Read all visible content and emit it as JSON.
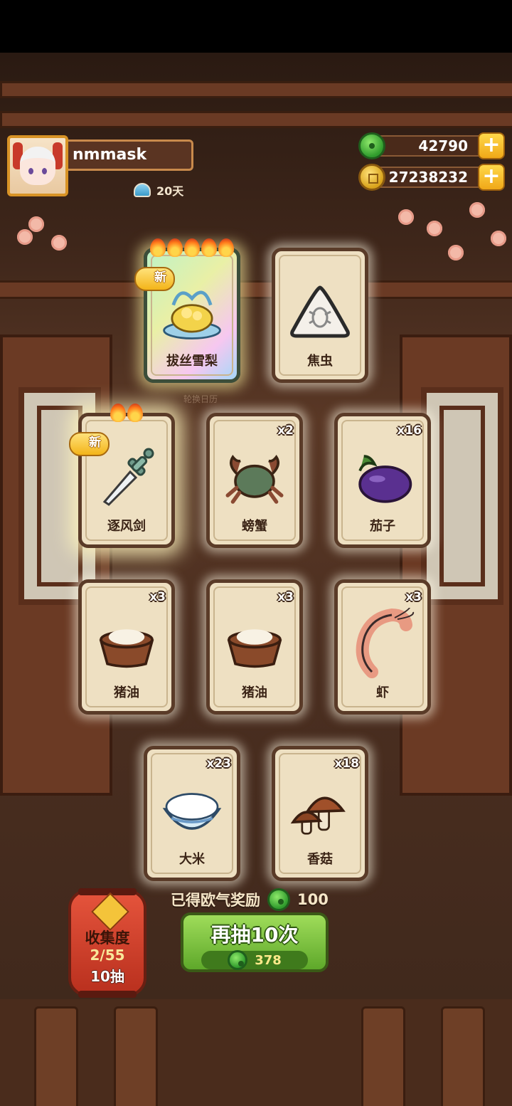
{
  "player": {
    "name": "nmmask",
    "days": "20天"
  },
  "currencies": {
    "jade": "42790",
    "gold": "27238232"
  },
  "subtitle": "轮换日历",
  "cards": [
    {
      "label": "拔丝雪梨",
      "count": "",
      "new": "新",
      "flames": 5,
      "rarity": "rare",
      "icon": "pear-dessert-icon"
    },
    {
      "label": "焦虫",
      "count": "",
      "new": "",
      "flames": 0,
      "rarity": "normal",
      "icon": "bug-triangle-icon"
    },
    {
      "label": "逐风剑",
      "count": "",
      "new": "新",
      "flames": 2,
      "rarity": "glow",
      "icon": "sword-icon"
    },
    {
      "label": "螃蟹",
      "count": "x2",
      "new": "",
      "flames": 0,
      "rarity": "normal",
      "icon": "crab-icon"
    },
    {
      "label": "茄子",
      "count": "x16",
      "new": "",
      "flames": 0,
      "rarity": "normal",
      "icon": "eggplant-icon"
    },
    {
      "label": "猪油",
      "count": "x3",
      "new": "",
      "flames": 0,
      "rarity": "normal",
      "icon": "lard-bowl-icon"
    },
    {
      "label": "猪油",
      "count": "x3",
      "new": "",
      "flames": 0,
      "rarity": "normal",
      "icon": "lard-bowl-icon"
    },
    {
      "label": "虾",
      "count": "x3",
      "new": "",
      "flames": 0,
      "rarity": "normal",
      "icon": "shrimp-icon"
    },
    {
      "label": "大米",
      "count": "x23",
      "new": "",
      "flames": 0,
      "rarity": "normal",
      "icon": "rice-bowl-icon"
    },
    {
      "label": "香菇",
      "count": "x18",
      "new": "",
      "flames": 0,
      "rarity": "normal",
      "icon": "mushroom-icon"
    }
  ],
  "reward": {
    "label": "已得欧气奖励",
    "amount": "100"
  },
  "collection": {
    "title": "收集度",
    "progress": "2/55",
    "draws": "10抽"
  },
  "draw_button": {
    "label": "再抽10次",
    "cost": "378"
  },
  "colors": {
    "jade": "#2f9b2c",
    "gold": "#d8a21a",
    "button_green": "#5ea82a",
    "card_bg": "#eee0c2"
  }
}
